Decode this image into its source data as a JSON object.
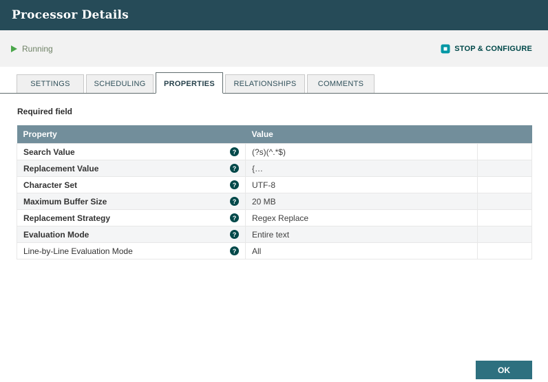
{
  "window": {
    "title": "Processor Details"
  },
  "status_bar": {
    "state_label": "Running",
    "action_label": "STOP & CONFIGURE"
  },
  "tabs": [
    {
      "label": "SETTINGS",
      "active": false
    },
    {
      "label": "SCHEDULING",
      "active": false
    },
    {
      "label": "PROPERTIES",
      "active": true
    },
    {
      "label": "RELATIONSHIPS",
      "active": false,
      "wide": true
    },
    {
      "label": "COMMENTS",
      "active": false
    }
  ],
  "required_field_note": "Required field",
  "properties_table": {
    "columns": {
      "property": "Property",
      "value": "Value"
    },
    "help_glyph": "?",
    "rows": [
      {
        "property": "Search Value",
        "value": "(?s)(^.*$)",
        "required": true
      },
      {
        "property": "Replacement Value",
        "value": "{…",
        "required": true
      },
      {
        "property": "Character Set",
        "value": "UTF-8",
        "required": true
      },
      {
        "property": "Maximum Buffer Size",
        "value": "20 MB",
        "required": true
      },
      {
        "property": "Replacement Strategy",
        "value": "Regex Replace",
        "required": true
      },
      {
        "property": "Evaluation Mode",
        "value": "Entire text",
        "required": true
      },
      {
        "property": "Line-by-Line Evaluation Mode",
        "value": "All",
        "required": false
      }
    ]
  },
  "footer": {
    "ok_label": "OK"
  },
  "colors": {
    "header_bg": "#264b58",
    "status_bar_bg": "#f2f2f2",
    "running_green": "#4aa64a",
    "action_teal": "#0097a4",
    "action_text": "#004849",
    "table_header_bg": "#728e9b",
    "row_alt_bg": "#f4f5f6",
    "help_icon_bg": "#004849",
    "ok_button_bg": "#2e707f"
  }
}
